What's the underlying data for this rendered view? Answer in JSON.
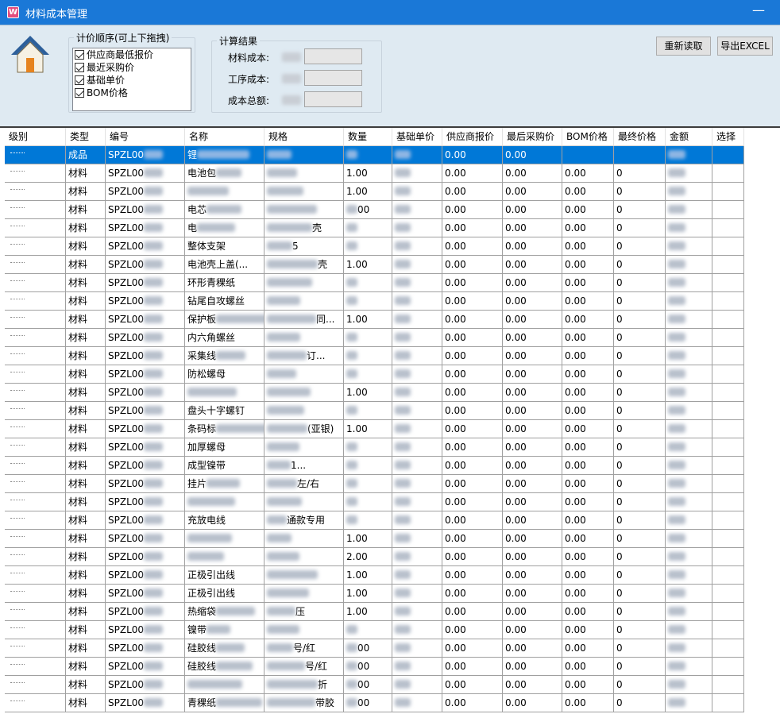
{
  "window": {
    "title": "材料成本管理",
    "minimize_glyph": "—",
    "app_icon": "W"
  },
  "priority": {
    "legend": "计价顺序(可上下拖拽)",
    "items": [
      {
        "label": "供应商最低报价",
        "checked": true
      },
      {
        "label": "最近采购价",
        "checked": true
      },
      {
        "label": "基础单价",
        "checked": true
      },
      {
        "label": "BOM价格",
        "checked": true
      }
    ]
  },
  "results": {
    "legend": "计算结果",
    "material_cost_label": "材料成本:",
    "process_cost_label": "工序成本:",
    "total_cost_label": "成本总额:"
  },
  "buttons": {
    "reload": "重新读取",
    "export": "导出EXCEL"
  },
  "grid": {
    "columns": [
      "级别",
      "类型",
      "编号",
      "名称",
      "规格",
      "数量",
      "基础单价",
      "供应商报价",
      "最后采购价",
      "BOM价格",
      "最终价格",
      "金额",
      "选择"
    ],
    "rows": [
      {
        "type": "成品",
        "code": "SPZL00",
        "name": "锂",
        "spec": "",
        "qty": "",
        "supplier": "0.00",
        "last": "0.00",
        "bom": "",
        "final": ""
      },
      {
        "type": "材料",
        "code": "SPZL00",
        "name": "电池包",
        "spec": "",
        "qty": "1.00",
        "supplier": "0.00",
        "last": "0.00",
        "bom": "0.00",
        "final": "0"
      },
      {
        "type": "材料",
        "code": "SPZL00",
        "name": "",
        "spec": "",
        "qty": "1.00",
        "supplier": "0.00",
        "last": "0.00",
        "bom": "0.00",
        "final": "0"
      },
      {
        "type": "材料",
        "code": "SPZL00",
        "name": "电芯",
        "spec": "",
        "qty": "00",
        "supplier": "0.00",
        "last": "0.00",
        "bom": "0.00",
        "final": "0"
      },
      {
        "type": "材料",
        "code": "SPZL00",
        "name": "电",
        "spec": "壳",
        "qty": "",
        "supplier": "0.00",
        "last": "0.00",
        "bom": "0.00",
        "final": "0"
      },
      {
        "type": "材料",
        "code": "SPZL00",
        "name": "整体支架",
        "spec": "5",
        "qty": "",
        "supplier": "0.00",
        "last": "0.00",
        "bom": "0.00",
        "final": "0"
      },
      {
        "type": "材料",
        "code": "SPZL00",
        "name": "电池壳上盖(...",
        "spec": "壳",
        "qty": "1.00",
        "supplier": "0.00",
        "last": "0.00",
        "bom": "0.00",
        "final": "0"
      },
      {
        "type": "材料",
        "code": "SPZL00",
        "name": "环形青稞纸",
        "spec": "",
        "qty": "",
        "supplier": "0.00",
        "last": "0.00",
        "bom": "0.00",
        "final": "0"
      },
      {
        "type": "材料",
        "code": "SPZL00",
        "name": "钻尾自攻螺丝",
        "spec": "",
        "qty": "",
        "supplier": "0.00",
        "last": "0.00",
        "bom": "0.00",
        "final": "0"
      },
      {
        "type": "材料",
        "code": "SPZL00",
        "name": "保护板",
        "spec": "同...",
        "qty": "1.00",
        "supplier": "0.00",
        "last": "0.00",
        "bom": "0.00",
        "final": "0"
      },
      {
        "type": "材料",
        "code": "SPZL00",
        "name": "内六角螺丝",
        "spec": "",
        "qty": "",
        "supplier": "0.00",
        "last": "0.00",
        "bom": "0.00",
        "final": "0"
      },
      {
        "type": "材料",
        "code": "SPZL00",
        "name": "采集线",
        "spec": "订...",
        "qty": "",
        "supplier": "0.00",
        "last": "0.00",
        "bom": "0.00",
        "final": "0"
      },
      {
        "type": "材料",
        "code": "SPZL00",
        "name": "防松螺母",
        "spec": "",
        "qty": "",
        "supplier": "0.00",
        "last": "0.00",
        "bom": "0.00",
        "final": "0"
      },
      {
        "type": "材料",
        "code": "SPZL00",
        "name": "",
        "spec": "",
        "qty": "1.00",
        "supplier": "0.00",
        "last": "0.00",
        "bom": "0.00",
        "final": "0"
      },
      {
        "type": "材料",
        "code": "SPZL00",
        "name": "盘头十字螺钉",
        "spec": "",
        "qty": "",
        "supplier": "0.00",
        "last": "0.00",
        "bom": "0.00",
        "final": "0"
      },
      {
        "type": "材料",
        "code": "SPZL00",
        "name": "条码标",
        "spec": "(亚银)",
        "qty": "1.00",
        "supplier": "0.00",
        "last": "0.00",
        "bom": "0.00",
        "final": "0"
      },
      {
        "type": "材料",
        "code": "SPZL00",
        "name": "加厚螺母",
        "spec": "",
        "qty": "",
        "supplier": "0.00",
        "last": "0.00",
        "bom": "0.00",
        "final": "0"
      },
      {
        "type": "材料",
        "code": "SPZL00",
        "name": "成型镍带",
        "spec": "1...",
        "qty": "",
        "supplier": "0.00",
        "last": "0.00",
        "bom": "0.00",
        "final": "0"
      },
      {
        "type": "材料",
        "code": "SPZL00",
        "name": "挂片",
        "spec": "左/右",
        "qty": "",
        "supplier": "0.00",
        "last": "0.00",
        "bom": "0.00",
        "final": "0"
      },
      {
        "type": "材料",
        "code": "SPZL00",
        "name": "",
        "spec": "",
        "qty": "",
        "supplier": "0.00",
        "last": "0.00",
        "bom": "0.00",
        "final": "0"
      },
      {
        "type": "材料",
        "code": "SPZL00",
        "name": "充放电线",
        "spec": "通款专用",
        "qty": "",
        "supplier": "0.00",
        "last": "0.00",
        "bom": "0.00",
        "final": "0"
      },
      {
        "type": "材料",
        "code": "SPZL00",
        "name": "",
        "spec": "",
        "qty": "1.00",
        "supplier": "0.00",
        "last": "0.00",
        "bom": "0.00",
        "final": "0"
      },
      {
        "type": "材料",
        "code": "SPZL00",
        "name": "",
        "spec": "",
        "qty": "2.00",
        "supplier": "0.00",
        "last": "0.00",
        "bom": "0.00",
        "final": "0"
      },
      {
        "type": "材料",
        "code": "SPZL00",
        "name": "正极引出线",
        "spec": "",
        "qty": "1.00",
        "supplier": "0.00",
        "last": "0.00",
        "bom": "0.00",
        "final": "0"
      },
      {
        "type": "材料",
        "code": "SPZL00",
        "name": "正极引出线",
        "spec": "",
        "qty": "1.00",
        "supplier": "0.00",
        "last": "0.00",
        "bom": "0.00",
        "final": "0"
      },
      {
        "type": "材料",
        "code": "SPZL00",
        "name": "热缩袋",
        "spec": "压",
        "qty": "1.00",
        "supplier": "0.00",
        "last": "0.00",
        "bom": "0.00",
        "final": "0"
      },
      {
        "type": "材料",
        "code": "SPZL00",
        "name": "镍带",
        "spec": "",
        "qty": "",
        "supplier": "0.00",
        "last": "0.00",
        "bom": "0.00",
        "final": "0"
      },
      {
        "type": "材料",
        "code": "SPZL00",
        "name": "硅胶线",
        "spec": "号/红",
        "qty": "00",
        "supplier": "0.00",
        "last": "0.00",
        "bom": "0.00",
        "final": "0"
      },
      {
        "type": "材料",
        "code": "SPZL00",
        "name": "硅胶线",
        "spec": "号/红",
        "qty": "00",
        "supplier": "0.00",
        "last": "0.00",
        "bom": "0.00",
        "final": "0"
      },
      {
        "type": "材料",
        "code": "SPZL00",
        "name": "",
        "spec": "折",
        "qty": "00",
        "supplier": "0.00",
        "last": "0.00",
        "bom": "0.00",
        "final": "0"
      },
      {
        "type": "材料",
        "code": "SPZL00",
        "name": "青稞纸",
        "spec": "带胶",
        "qty": "00",
        "supplier": "0.00",
        "last": "0.00",
        "bom": "0.00",
        "final": "0"
      }
    ]
  }
}
